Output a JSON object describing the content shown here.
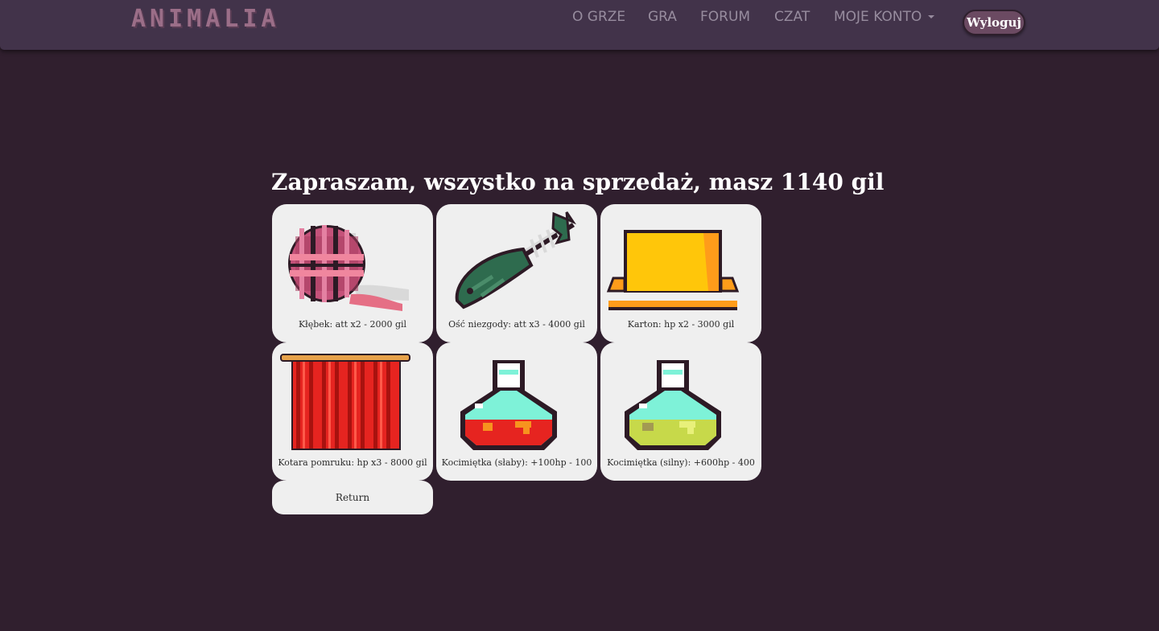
{
  "brand": {
    "logo_text": "ANIMALIA"
  },
  "nav": {
    "items": [
      {
        "label": "O GRZE"
      },
      {
        "label": "GRA"
      },
      {
        "label": "FORUM"
      },
      {
        "label": "CZAT"
      },
      {
        "label": "MOJE KONTO"
      }
    ],
    "logout_label": "Wyloguj"
  },
  "shop": {
    "title": "Zapraszam, wszystko na sprzedaż, masz 1140 gil",
    "items": [
      {
        "label": "Kłębek: att x2 - 2000 gil",
        "icon": "yarn-ball-icon"
      },
      {
        "label": "Ość niezgody: att x3 - 4000 gil",
        "icon": "fish-bone-icon"
      },
      {
        "label": "Karton: hp x2 - 3000 gil",
        "icon": "cardboard-box-icon"
      },
      {
        "label": "Kotara pomruku: hp x3 - 8000 gil",
        "icon": "curtain-icon"
      },
      {
        "label": "Kocimiętka (słaby): +100hp - 100",
        "icon": "red-potion-icon"
      },
      {
        "label": "Kocimiętka (silny): +600hp - 400",
        "icon": "yellow-potion-icon"
      }
    ],
    "return_label": "Return"
  },
  "colors": {
    "background": "#301f2e",
    "navbar": "#42334a",
    "card": "#efefef",
    "logout_button": "#6b4a62"
  }
}
